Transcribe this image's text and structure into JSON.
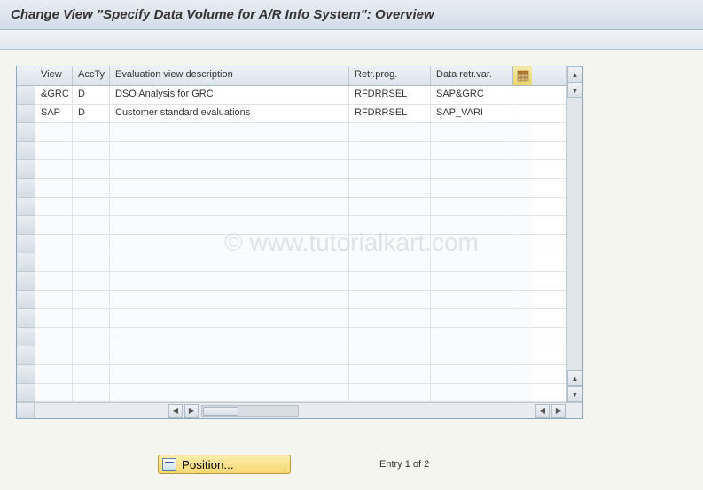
{
  "title": "Change View \"Specify Data Volume for A/R Info System\": Overview",
  "watermark": "© www.tutorialkart.com",
  "columns": {
    "view": "View",
    "accty": "AccTy",
    "desc": "Evaluation view description",
    "retr": "Retr.prog.",
    "datavar": "Data retr.var."
  },
  "rows": [
    {
      "view": "&GRC",
      "accty": "D",
      "desc": "DSO Analysis for GRC",
      "retr": "RFDRRSEL",
      "datavar": "SAP&GRC"
    },
    {
      "view": "SAP",
      "accty": "D",
      "desc": "Customer standard evaluations",
      "retr": "RFDRRSEL",
      "datavar": "SAP_VARI"
    }
  ],
  "footer": {
    "position_label": "Position...",
    "entry_text": "Entry 1 of 2"
  }
}
